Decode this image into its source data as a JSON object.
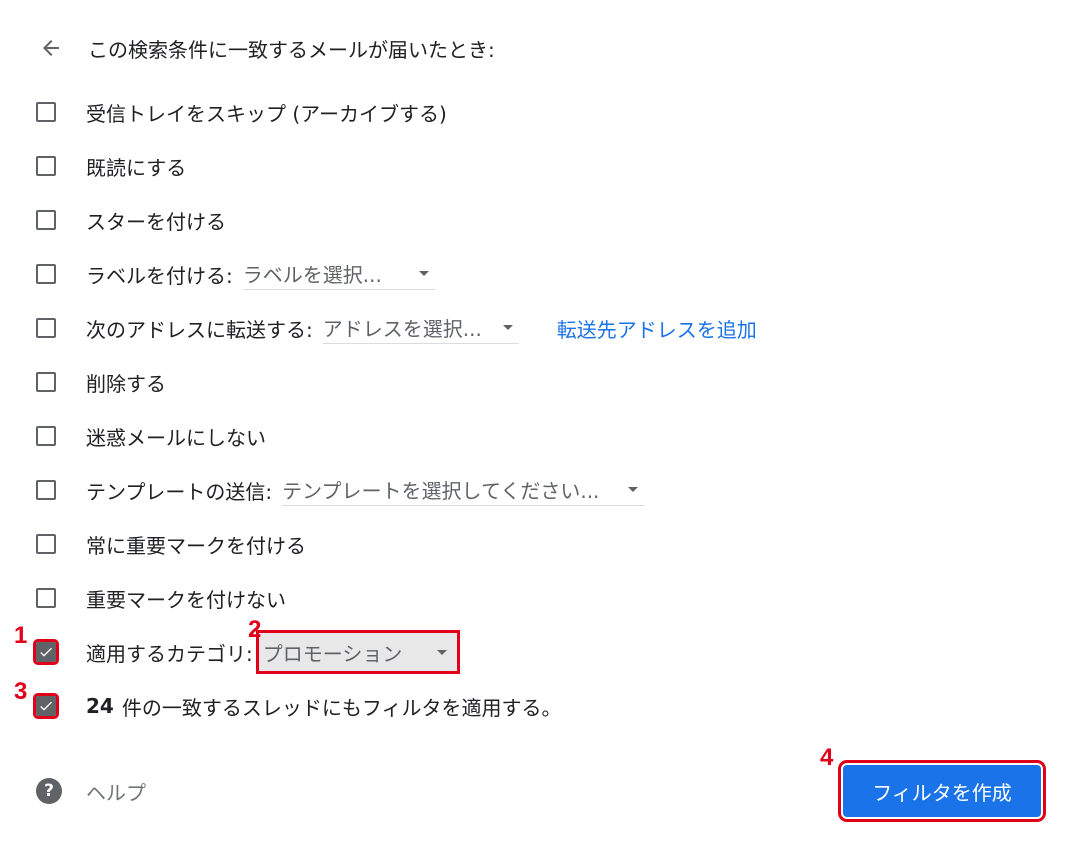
{
  "header": {
    "back_icon": "arrow-left-icon",
    "title": "この検索条件に一致するメールが届いたとき:"
  },
  "options": [
    {
      "label": "受信トレイをスキップ (アーカイブする)",
      "checked": false
    },
    {
      "label": "既読にする",
      "checked": false
    },
    {
      "label": "スターを付ける",
      "checked": false
    },
    {
      "label": "ラベルを付ける:",
      "checked": false,
      "select": "ラベルを選択..."
    },
    {
      "label": "次のアドレスに転送する:",
      "checked": false,
      "select": "アドレスを選択...",
      "link": "転送先アドレスを追加"
    },
    {
      "label": "削除する",
      "checked": false
    },
    {
      "label": "迷惑メールにしない",
      "checked": false
    },
    {
      "label": "テンプレートの送信:",
      "checked": false,
      "select": "テンプレートを選択してください..."
    },
    {
      "label": "常に重要マークを付ける",
      "checked": false
    },
    {
      "label": "重要マークを付けない",
      "checked": false
    },
    {
      "label": "適用するカテゴリ:",
      "checked": true,
      "select": "プロモーション"
    }
  ],
  "apply_existing": {
    "count": "24",
    "label": "件の一致するスレッドにもフィルタを適用する。",
    "checked": true
  },
  "help": {
    "icon": "help-circle-icon",
    "label": "ヘルプ"
  },
  "create_button": {
    "label": "フィルタを作成"
  },
  "annotations": {
    "step1": "1",
    "step2": "2",
    "step3": "3",
    "step4": "4"
  },
  "colors": {
    "accent": "#1a73e8",
    "annotation": "#e0001a",
    "checkbox": "#5f6368"
  }
}
